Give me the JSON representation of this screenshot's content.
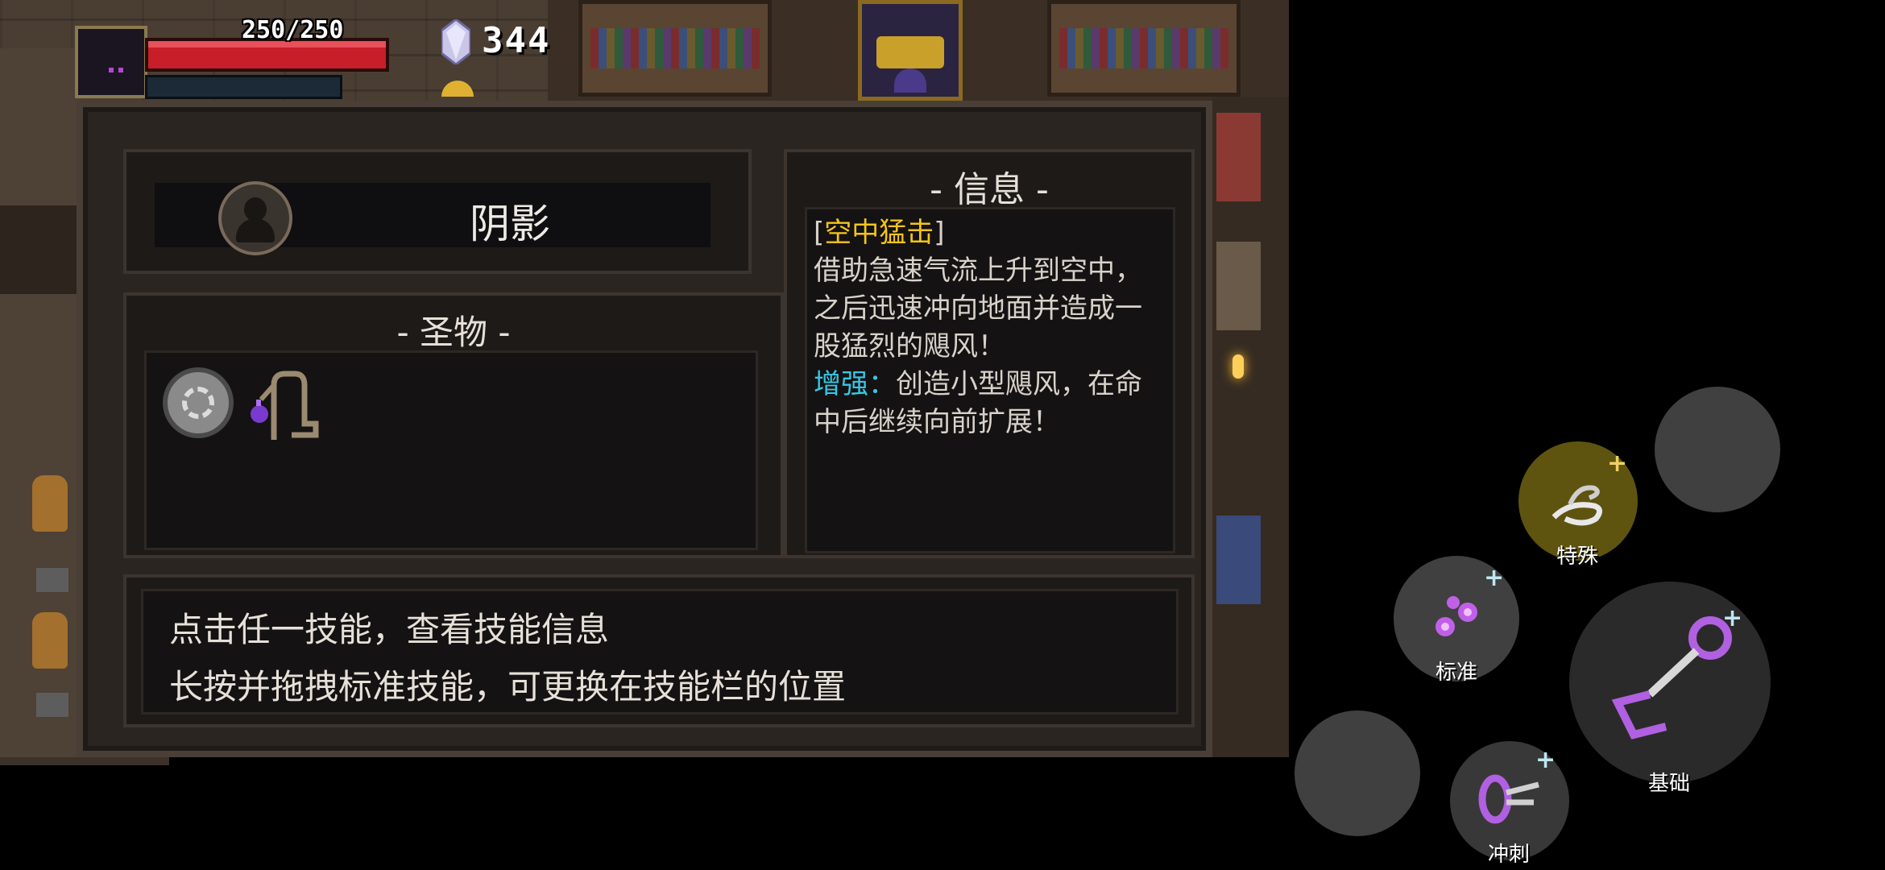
{
  "hud": {
    "hp_text": "250/250",
    "gem_count": "344",
    "hp_fraction": 1.0
  },
  "panel": {
    "character_name": "阴影",
    "relics_title": "- 圣物 -",
    "relics": [
      {
        "icon": "silver-rune-disc-icon"
      },
      {
        "icon": "purple-flame-lamp-icon"
      }
    ],
    "info_title": "- 信息 -",
    "info": {
      "open_bracket": "[",
      "skill_name": "空中猛击",
      "close_bracket": "]",
      "description": "借助急速气流上升到空中，之后迅速冲向地面并造成一股猛烈的飓风！",
      "boost_label": "增强：",
      "boost_text": "创造小型飓风，在命中后继续向前扩展！"
    },
    "hints": [
      "点击任一技能，查看技能信息",
      "长按并拖拽标准技能，可更换在技能栏的位置"
    ]
  },
  "skills": {
    "special": {
      "label": "特殊",
      "icon": "wind-tornado-icon",
      "plus": "+"
    },
    "standard": {
      "label": "标准",
      "icon": "purple-claw-icon",
      "plus": "+"
    },
    "basic": {
      "label": "基础",
      "icon": "purple-chain-icon",
      "plus": "+"
    },
    "dash": {
      "label": "冲刺",
      "icon": "purple-dash-icon",
      "plus": "+"
    }
  },
  "colors": {
    "skill_name": "#f5c518",
    "boost_label": "#36c8e6",
    "hp": "#c81e2a",
    "special_bg": "#6b5e10"
  }
}
